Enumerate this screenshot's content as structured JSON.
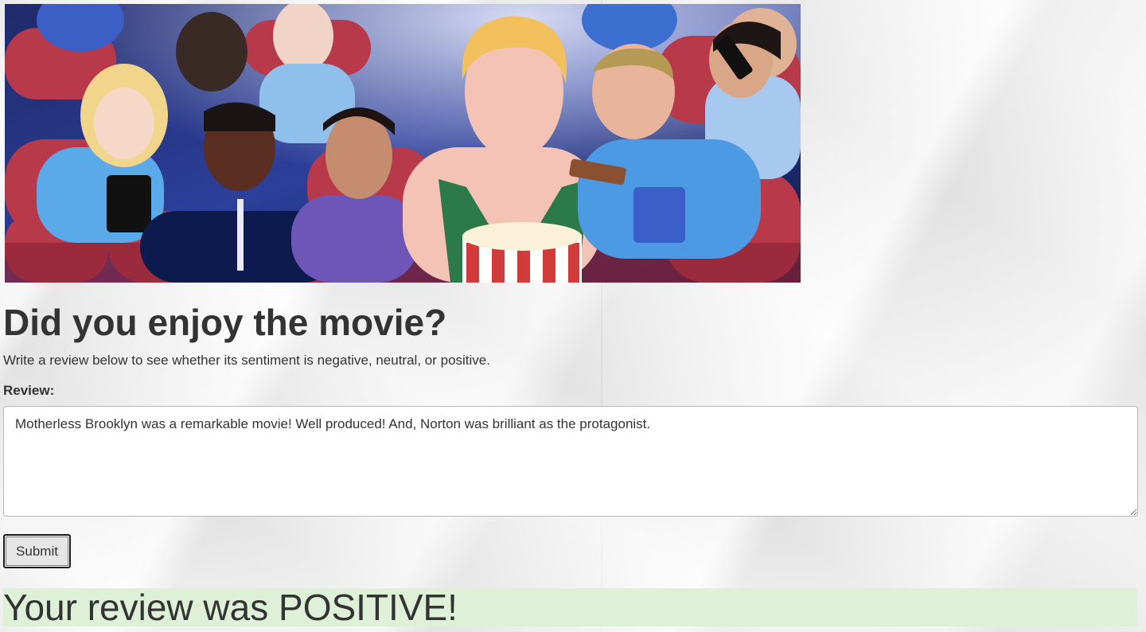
{
  "hero": {
    "image_alt": "Illustrated cinema audience",
    "accent_colors": [
      "#0d1a4a",
      "#b8394a",
      "#4aa3e0",
      "#f2c05c"
    ]
  },
  "page": {
    "title": "Did you enjoy the movie?",
    "subtitle": "Write a review below to see whether its sentiment is negative, neutral, or positive."
  },
  "form": {
    "review_label": "Review:",
    "review_value": "Motherless Brooklyn was a remarkable movie! Well produced! And, Norton was brilliant as the protagonist.",
    "submit_label": "Submit"
  },
  "result": {
    "text": "Your review was POSITIVE!",
    "status_color": "#dff0d8"
  }
}
